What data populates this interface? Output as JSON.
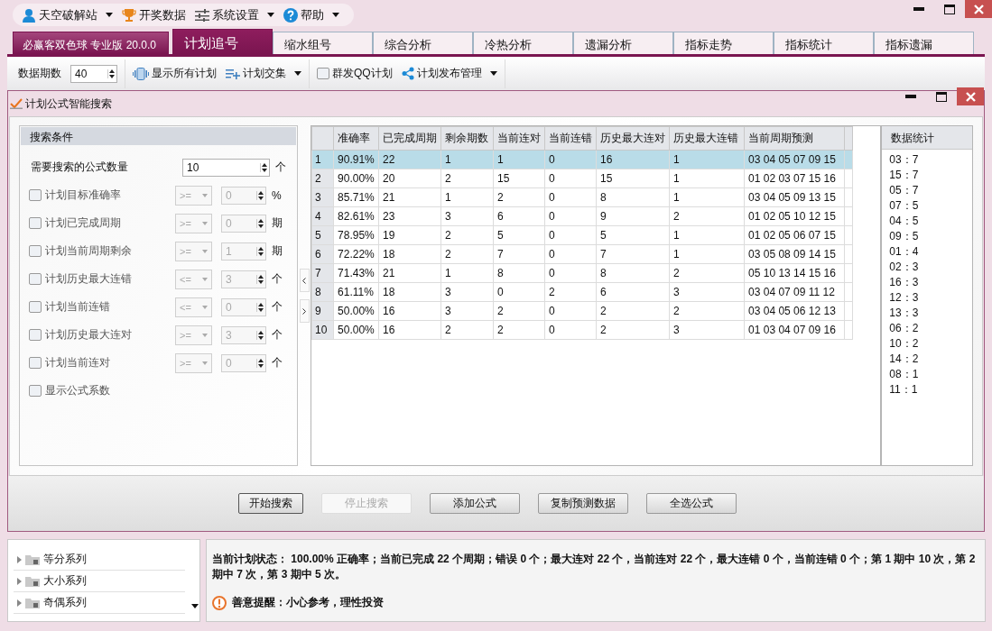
{
  "menu": [
    {
      "label": "天空破解站",
      "dropdown": true
    },
    {
      "label": "开奖数据",
      "dropdown": false
    },
    {
      "label": "系统设置",
      "dropdown": true
    },
    {
      "label": "帮助",
      "dropdown": true
    }
  ],
  "tabs": [
    {
      "label": "必赢客双色球 专业版 20.0.0",
      "kind": "brand",
      "selected": false
    },
    {
      "label": "计划追号",
      "kind": "tab",
      "selected": true
    },
    {
      "label": "缩水组号",
      "kind": "tab",
      "selected": false
    },
    {
      "label": "综合分析",
      "kind": "tab",
      "selected": false
    },
    {
      "label": "冷热分析",
      "kind": "tab",
      "selected": false
    },
    {
      "label": "遗漏分析",
      "kind": "tab",
      "selected": false
    },
    {
      "label": "指标走势",
      "kind": "tab",
      "selected": false
    },
    {
      "label": "指标统计",
      "kind": "tab",
      "selected": false
    },
    {
      "label": "指标遗漏",
      "kind": "tab",
      "selected": false
    }
  ],
  "ribbon": {
    "period_label": "数据期数",
    "period_value": "40",
    "groups": [
      [
        {
          "label": "显示所有计划",
          "kind": "button",
          "dropdown": false
        },
        {
          "label": "计划交集",
          "kind": "button",
          "dropdown": true
        }
      ],
      [
        {
          "label": "群发QQ计划",
          "kind": "checkbox",
          "checked": false,
          "dropdown": false
        },
        {
          "label": "计划发布管理",
          "kind": "button",
          "dropdown": true
        }
      ]
    ]
  },
  "dialog": {
    "title": "计划公式智能搜索",
    "search_conditions": {
      "title": "搜索条件",
      "count_label": "需要搜索的公式数量",
      "count_value": "10",
      "count_unit": "个",
      "items": [
        {
          "kind": "range",
          "label": "计划目标准确率",
          "checked": false,
          "operator": ">=",
          "value": "0",
          "unit": "%"
        },
        {
          "kind": "range",
          "label": "计划已完成周期",
          "checked": false,
          "operator": ">=",
          "value": "0",
          "unit": "期"
        },
        {
          "kind": "range",
          "label": "计划当前周期剩余",
          "checked": false,
          "operator": ">=",
          "value": "1",
          "unit": "期"
        },
        {
          "kind": "range",
          "label": "计划历史最大连错",
          "checked": false,
          "operator": "<=",
          "value": "3",
          "unit": "个"
        },
        {
          "kind": "range",
          "label": "计划当前连错",
          "checked": false,
          "operator": "<=",
          "value": "0",
          "unit": "个"
        },
        {
          "kind": "range",
          "label": "计划历史最大连对",
          "checked": false,
          "operator": ">=",
          "value": "3",
          "unit": "个"
        },
        {
          "kind": "range",
          "label": "计划当前连对",
          "checked": false,
          "operator": ">=",
          "value": "0",
          "unit": "个"
        },
        {
          "kind": "flag",
          "label": "显示公式系数",
          "checked": false
        }
      ]
    },
    "table": {
      "columns": [
        "准确率",
        "已完成周期",
        "剩余期数",
        "当前连对",
        "当前连错",
        "历史最大连对",
        "历史最大连错",
        "当前周期预测"
      ],
      "rows": [
        {
          "index": "1",
          "selected": true,
          "cells": [
            "90.91%",
            "22",
            "1",
            "1",
            "0",
            "16",
            "1",
            "03 04 05 07 09 15"
          ]
        },
        {
          "index": "2",
          "selected": false,
          "cells": [
            "90.00%",
            "20",
            "2",
            "15",
            "0",
            "15",
            "1",
            "01 02 03 07 15 16"
          ]
        },
        {
          "index": "3",
          "selected": false,
          "cells": [
            "85.71%",
            "21",
            "1",
            "2",
            "0",
            "8",
            "1",
            "03 04 05 09 13 15"
          ]
        },
        {
          "index": "4",
          "selected": false,
          "cells": [
            "82.61%",
            "23",
            "3",
            "6",
            "0",
            "9",
            "2",
            "01 02 05 10 12 15"
          ]
        },
        {
          "index": "5",
          "selected": false,
          "cells": [
            "78.95%",
            "19",
            "2",
            "5",
            "0",
            "5",
            "1",
            "01 02 05 06 07 15"
          ]
        },
        {
          "index": "6",
          "selected": false,
          "cells": [
            "72.22%",
            "18",
            "2",
            "7",
            "0",
            "7",
            "1",
            "03 05 08 09 14 15"
          ]
        },
        {
          "index": "7",
          "selected": false,
          "cells": [
            "71.43%",
            "21",
            "1",
            "8",
            "0",
            "8",
            "2",
            "05 10 13 14 15 16"
          ]
        },
        {
          "index": "8",
          "selected": false,
          "cells": [
            "61.11%",
            "18",
            "3",
            "0",
            "2",
            "6",
            "3",
            "03 04 07 09 11 12"
          ]
        },
        {
          "index": "9",
          "selected": false,
          "cells": [
            "50.00%",
            "16",
            "3",
            "2",
            "0",
            "2",
            "2",
            "03 04 05 06 12 13"
          ]
        },
        {
          "index": "10",
          "selected": false,
          "cells": [
            "50.00%",
            "16",
            "2",
            "2",
            "0",
            "2",
            "3",
            "01 03 04 07 09 16"
          ]
        }
      ]
    },
    "stats": {
      "title": "数据统计",
      "items": [
        "03：7",
        "15：7",
        "05：7",
        "07：5",
        "04：5",
        "09：5",
        "01：4",
        "02：3",
        "16：3",
        "12：3",
        "13：3",
        "06：2",
        "10：2",
        "14：2",
        "08：1",
        "11：1"
      ]
    },
    "buttons": [
      {
        "label": "开始搜索",
        "disabled": false,
        "selected": true
      },
      {
        "label": "停止搜索",
        "disabled": true,
        "selected": false
      },
      {
        "label": "添加公式",
        "disabled": false,
        "selected": false
      },
      {
        "label": "复制预测数据",
        "disabled": false,
        "selected": false
      },
      {
        "label": "全选公式",
        "disabled": false,
        "selected": false
      }
    ]
  },
  "tree": {
    "items": [
      {
        "label": "等分系列",
        "expanded": false
      },
      {
        "label": "大小系列",
        "expanded": false
      },
      {
        "label": "奇偶系列",
        "expanded": false
      }
    ]
  },
  "info": {
    "status": "当前计划状态： 100.00% 正确率；当前已完成 22 个周期；错误 0 个；最大连对 22 个，当前连对 22 个，最大连错 0 个，当前连错 0 个；第 1 期中 10 次，第 2 期中 7 次，第 3 期中 5 次。",
    "reminder": "善意提醒：小心参考，理性投资"
  }
}
